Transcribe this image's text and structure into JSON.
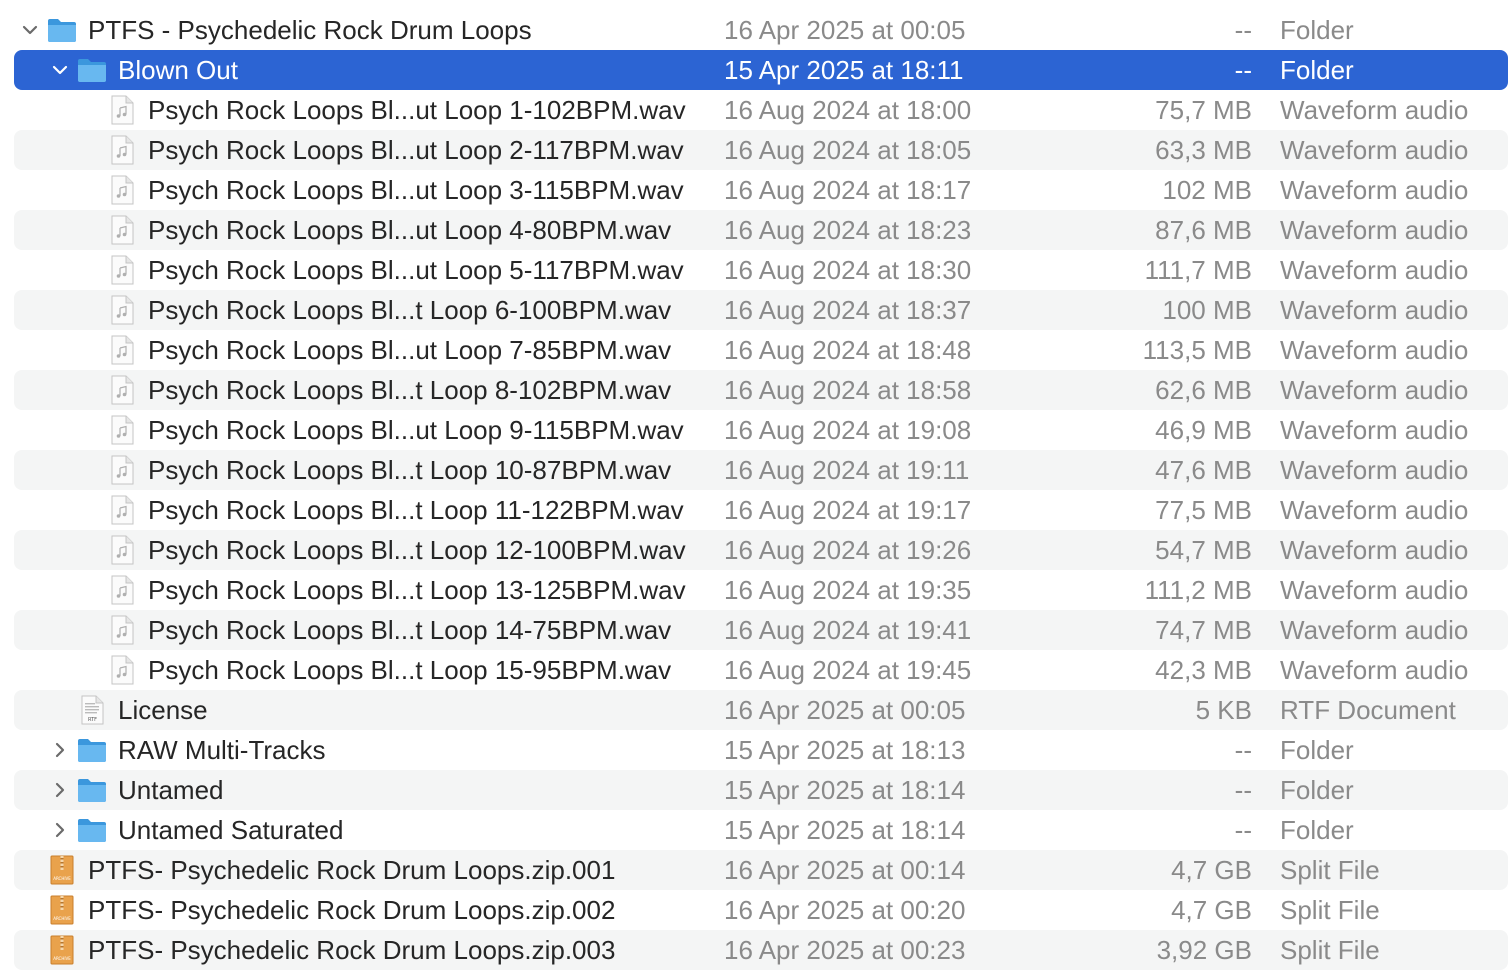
{
  "rows": [
    {
      "name": "PTFS - Psychedelic Rock Drum Loops",
      "date": "16 Apr 2025 at 00:05",
      "size": "--",
      "kind": "Folder",
      "level": 0,
      "icon": "folder",
      "disclosure": "open"
    },
    {
      "name": "Blown Out",
      "date": "15 Apr 2025 at 18:11",
      "size": "--",
      "kind": "Folder",
      "level": 1,
      "icon": "folder",
      "disclosure": "open",
      "selected": true
    },
    {
      "name": "Psych Rock Loops Bl...ut Loop 1-102BPM.wav",
      "date": "16 Aug 2024 at 18:00",
      "size": "75,7 MB",
      "kind": "Waveform audio",
      "level": 2,
      "icon": "audio"
    },
    {
      "name": "Psych Rock Loops Bl...ut Loop 2-117BPM.wav",
      "date": "16 Aug 2024 at 18:05",
      "size": "63,3 MB",
      "kind": "Waveform audio",
      "level": 2,
      "icon": "audio"
    },
    {
      "name": "Psych Rock Loops Bl...ut Loop 3-115BPM.wav",
      "date": "16 Aug 2024 at 18:17",
      "size": "102 MB",
      "kind": "Waveform audio",
      "level": 2,
      "icon": "audio"
    },
    {
      "name": "Psych Rock Loops Bl...ut Loop 4-80BPM.wav",
      "date": "16 Aug 2024 at 18:23",
      "size": "87,6 MB",
      "kind": "Waveform audio",
      "level": 2,
      "icon": "audio"
    },
    {
      "name": "Psych Rock Loops Bl...ut Loop 5-117BPM.wav",
      "date": "16 Aug 2024 at 18:30",
      "size": "111,7 MB",
      "kind": "Waveform audio",
      "level": 2,
      "icon": "audio"
    },
    {
      "name": "Psych Rock Loops Bl...t Loop 6-100BPM.wav",
      "date": "16 Aug 2024 at 18:37",
      "size": "100 MB",
      "kind": "Waveform audio",
      "level": 2,
      "icon": "audio"
    },
    {
      "name": "Psych Rock Loops Bl...ut Loop 7-85BPM.wav",
      "date": "16 Aug 2024 at 18:48",
      "size": "113,5 MB",
      "kind": "Waveform audio",
      "level": 2,
      "icon": "audio"
    },
    {
      "name": "Psych Rock Loops Bl...t Loop 8-102BPM.wav",
      "date": "16 Aug 2024 at 18:58",
      "size": "62,6 MB",
      "kind": "Waveform audio",
      "level": 2,
      "icon": "audio"
    },
    {
      "name": "Psych Rock Loops Bl...ut Loop 9-115BPM.wav",
      "date": "16 Aug 2024 at 19:08",
      "size": "46,9 MB",
      "kind": "Waveform audio",
      "level": 2,
      "icon": "audio"
    },
    {
      "name": "Psych Rock Loops Bl...t Loop 10-87BPM.wav",
      "date": "16 Aug 2024 at 19:11",
      "size": "47,6 MB",
      "kind": "Waveform audio",
      "level": 2,
      "icon": "audio"
    },
    {
      "name": "Psych Rock Loops Bl...t Loop 11-122BPM.wav",
      "date": "16 Aug 2024 at 19:17",
      "size": "77,5 MB",
      "kind": "Waveform audio",
      "level": 2,
      "icon": "audio"
    },
    {
      "name": "Psych Rock Loops Bl...t Loop 12-100BPM.wav",
      "date": "16 Aug 2024 at 19:26",
      "size": "54,7 MB",
      "kind": "Waveform audio",
      "level": 2,
      "icon": "audio"
    },
    {
      "name": "Psych Rock Loops Bl...t Loop 13-125BPM.wav",
      "date": "16 Aug 2024 at 19:35",
      "size": "111,2 MB",
      "kind": "Waveform audio",
      "level": 2,
      "icon": "audio"
    },
    {
      "name": "Psych Rock Loops Bl...t Loop 14-75BPM.wav",
      "date": "16 Aug 2024 at 19:41",
      "size": "74,7 MB",
      "kind": "Waveform audio",
      "level": 2,
      "icon": "audio"
    },
    {
      "name": "Psych Rock Loops Bl...t Loop 15-95BPM.wav",
      "date": "16 Aug 2024 at 19:45",
      "size": "42,3 MB",
      "kind": "Waveform audio",
      "level": 2,
      "icon": "audio"
    },
    {
      "name": "License",
      "date": "16 Apr 2025 at 00:05",
      "size": "5 KB",
      "kind": "RTF Document",
      "level": 1,
      "icon": "rtf",
      "icon_text": "RTF"
    },
    {
      "name": "RAW Multi-Tracks",
      "date": "15 Apr 2025 at 18:13",
      "size": "--",
      "kind": "Folder",
      "level": 1,
      "icon": "folder",
      "disclosure": "closed"
    },
    {
      "name": "Untamed",
      "date": "15 Apr 2025 at 18:14",
      "size": "--",
      "kind": "Folder",
      "level": 1,
      "icon": "folder",
      "disclosure": "closed"
    },
    {
      "name": "Untamed Saturated",
      "date": "15 Apr 2025 at 18:14",
      "size": "--",
      "kind": "Folder",
      "level": 1,
      "icon": "folder",
      "disclosure": "closed"
    },
    {
      "name": "PTFS- Psychedelic Rock Drum Loops.zip.001",
      "date": "16 Apr 2025 at 00:14",
      "size": "4,7 GB",
      "kind": "Split File",
      "level": 0,
      "icon": "archive",
      "icon_text": "ARCHIVE"
    },
    {
      "name": "PTFS- Psychedelic Rock Drum Loops.zip.002",
      "date": "16 Apr 2025 at 00:20",
      "size": "4,7 GB",
      "kind": "Split File",
      "level": 0,
      "icon": "archive",
      "icon_text": "ARCHIVE"
    },
    {
      "name": "PTFS- Psychedelic Rock Drum Loops.zip.003",
      "date": "16 Apr 2025 at 00:23",
      "size": "3,92 GB",
      "kind": "Split File",
      "level": 0,
      "icon": "archive",
      "icon_text": "ARCHIVE"
    }
  ],
  "colors": {
    "selection": "#2c64d3",
    "stripe": "#f4f5f5",
    "folder": "#5aaee8",
    "secondary_text": "#8a8a8a",
    "archive": "#e8a24a"
  }
}
